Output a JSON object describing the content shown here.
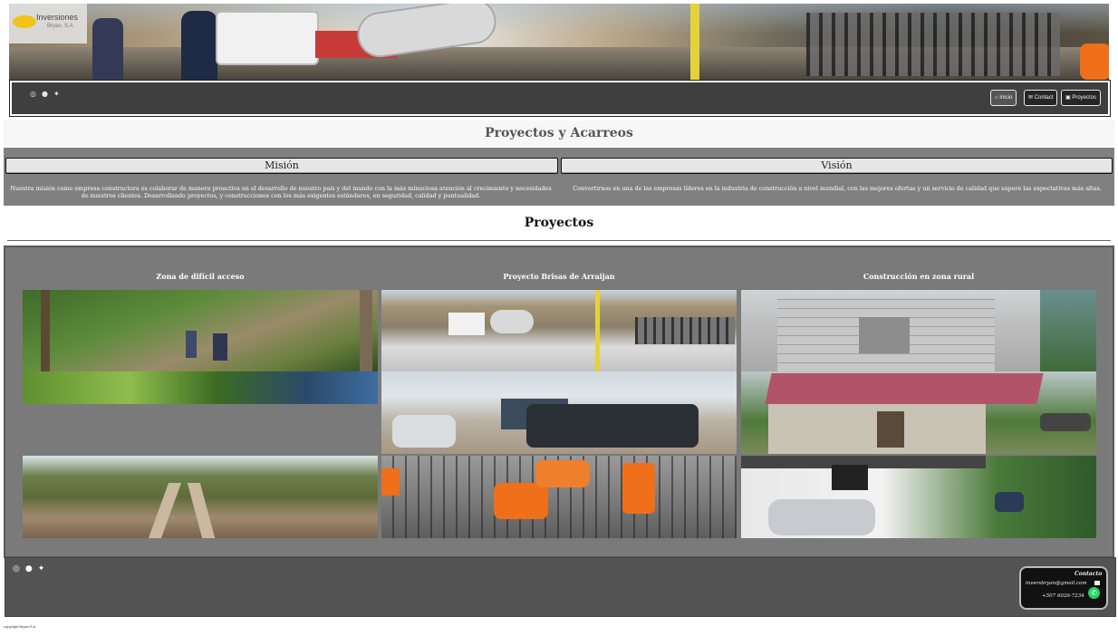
{
  "header": {
    "logo_text": "Inversiones",
    "logo_sub": "Bryan, S.A",
    "social": [
      "instagram-icon",
      "facebook-icon",
      "twitter-icon"
    ],
    "nav": [
      {
        "label": "Inicio",
        "icon": "home-icon",
        "active": true
      },
      {
        "label": "Contact",
        "icon": "mail-icon",
        "active": false
      },
      {
        "label": "Proyectos",
        "icon": "gallery-icon",
        "active": false
      }
    ]
  },
  "page_title": "Proyectos y Acarreos",
  "mission": {
    "heading": "Misión",
    "text": "Nuestra misión como empresa constructora es colaborar de manera proactiva en el desarrollo de nuestro país y del mundo con la más minuciosa atención al crecimiento y necesidades de nuestros clientes. Desarrollando proyectos, y construcciones con los más exigentes estándares, en seguridad, calidad y puntualidad."
  },
  "vision": {
    "heading": "Visión",
    "text": "Convertirnos en una de las empresas líderes en la industria de construcción a nivel mundial, con las mejores ofertas y un servicio de calidad que supere las expectativas más altas."
  },
  "projects": {
    "heading": "Proyectos",
    "columns": [
      {
        "title": "Zona de difícil acceso"
      },
      {
        "title": "Proyecto Brisas de Arraijan"
      },
      {
        "title": "Construcción en zona rural"
      }
    ]
  },
  "footer": {
    "social": [
      "instagram-icon",
      "facebook-icon",
      "twitter-icon"
    ],
    "contact_title": "Contacto",
    "email": "inversbryan@gmail.com",
    "phone": "+507 6026-7234",
    "copyright": "copyright Bryan S.A"
  },
  "colors": {
    "panel_gray": "#808080",
    "footer_gray": "#535353",
    "whatsapp_green": "#25d366"
  }
}
